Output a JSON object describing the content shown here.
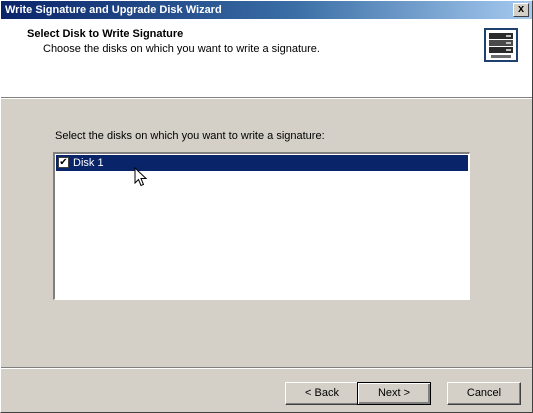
{
  "window": {
    "title": "Write Signature and Upgrade Disk Wizard",
    "close_label": "x"
  },
  "header": {
    "title": "Select Disk to Write Signature",
    "subtitle": "Choose the disks on which you want to write a signature."
  },
  "main": {
    "instruction": "Select the disks on which you want to write a signature:",
    "disks": [
      {
        "label": "Disk 1",
        "checked": true,
        "selected": true,
        "check_mark": "✔"
      }
    ]
  },
  "buttons": {
    "back": "< Back",
    "next": "Next >",
    "cancel": "Cancel"
  },
  "colors": {
    "selection": "#0a246a",
    "dialog_bg": "#d4d0c8"
  },
  "icons": {
    "wizard": "disk-stack-icon",
    "pointer": "mouse-cursor-icon"
  }
}
